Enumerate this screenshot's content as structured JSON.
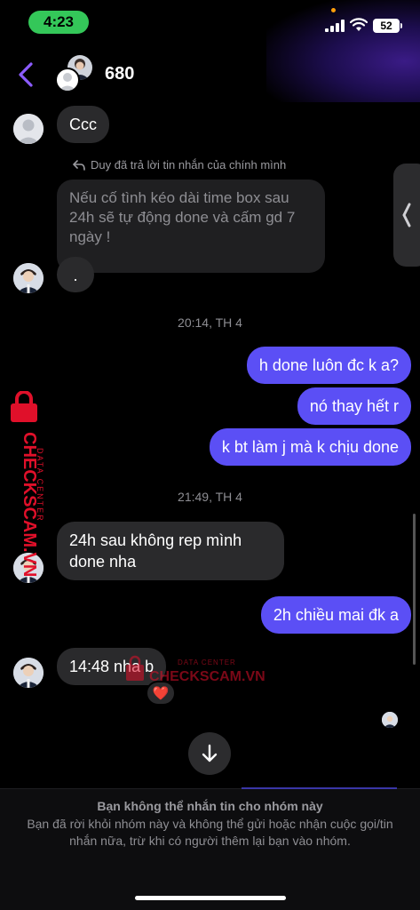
{
  "status_bar": {
    "time": "4:23",
    "battery": "52"
  },
  "header": {
    "title": "680"
  },
  "messages": {
    "m1": "Ccc",
    "reply_note": "Duy đã trả lời tin nhắn của chính mình",
    "quoted": "Nếu cố tình kéo dài time box sau 24h sẽ tự động done và cấm gd 7 ngày !",
    "m2": ".",
    "ts1": "20:14, TH 4",
    "out1": "h done luôn đc k a?",
    "out2": "nó thay hết r",
    "out3": "k bt làm j mà k chịu done",
    "ts2": "21:49, TH 4",
    "m3": "24h sau không rep mình done nha",
    "out4": "2h chiều mai đk a",
    "m4": "14:48 nha b"
  },
  "reaction": "❤️",
  "footer": {
    "title": "Bạn không thể nhắn tin cho nhóm này",
    "description": "Bạn đã rời khỏi nhóm này và không thể gửi hoặc nhận cuộc gọi/tin nhắn nữa, trừ khi có người thêm lại bạn vào nhóm."
  },
  "watermark": {
    "brand": "CHECKSCAM.VN",
    "tagline": "DATA CENTER"
  },
  "colors": {
    "outgoing_bubble": "#5b4ff5",
    "incoming_bubble": "#2a2a2c",
    "time_pill": "#34c759",
    "watermark": "#e0102a"
  }
}
